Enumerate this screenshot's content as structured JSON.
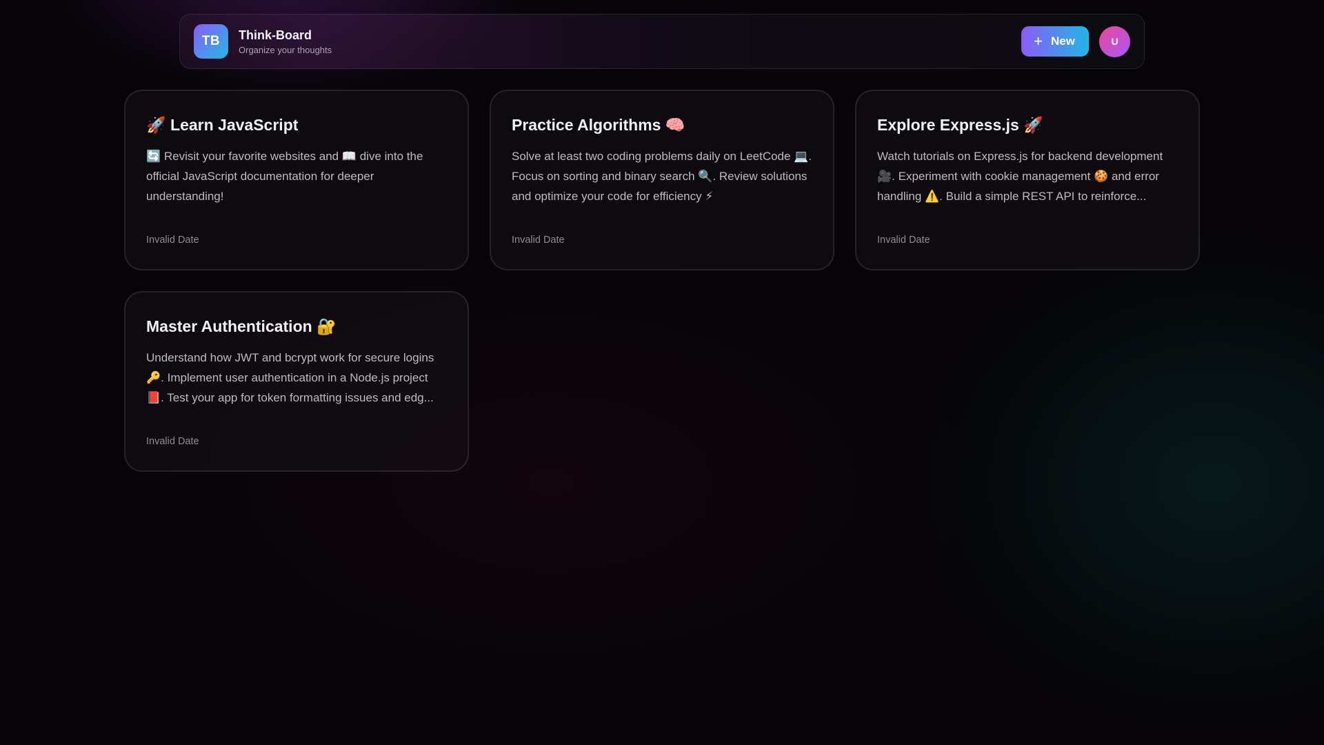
{
  "header": {
    "logo_text": "TB",
    "title": "Think-Board",
    "subtitle": "Organize your thoughts",
    "new_button_label": "New",
    "plus_icon": "+",
    "avatar_initial": "U"
  },
  "notes": [
    {
      "title": "🚀 Learn JavaScript",
      "body": "🔄 Revisit your favorite websites and 📖 dive into the official JavaScript documentation for deeper understanding!",
      "date": "Invalid Date"
    },
    {
      "title": "Practice Algorithms 🧠",
      "body": "Solve at least two coding problems daily on LeetCode 💻. Focus on sorting and binary search 🔍. Review solutions and optimize your code for efficiency ⚡",
      "date": "Invalid Date"
    },
    {
      "title": "Explore Express.js 🚀",
      "body": "Watch tutorials on Express.js for backend development 🎥. Experiment with cookie management 🍪 and error handling ⚠️. Build a simple REST API to reinforce...",
      "date": "Invalid Date"
    },
    {
      "title": "Master Authentication 🔐",
      "body": "Understand how JWT and bcrypt work for secure logins 🔑. Implement user authentication in a Node.js project 📕. Test your app for token formatting issues and edg...",
      "date": "Invalid Date"
    }
  ],
  "colors": {
    "accent_start": "#8b5cf6",
    "accent_end": "#22b8e6",
    "avatar": "#d946ef",
    "background": "#060407"
  }
}
